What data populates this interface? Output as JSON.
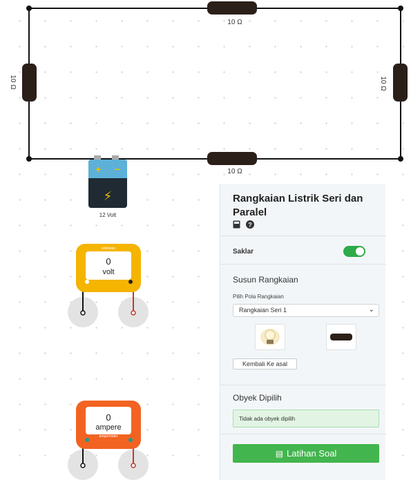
{
  "circuit": {
    "resistors": [
      {
        "label": "10 Ω"
      },
      {
        "label": "10 Ω"
      },
      {
        "label": "10 Ω"
      },
      {
        "label": "10 Ω"
      }
    ],
    "battery": {
      "label": "12 Volt",
      "plus": "+",
      "minus": "−",
      "bolt": "⚡"
    }
  },
  "voltmeter": {
    "title": "voltmeter",
    "value": "0",
    "unit": "volt"
  },
  "ammeter": {
    "title": "ampermeter",
    "value": "0",
    "unit": "ampere"
  },
  "panel": {
    "title": "Rangkaian Listrik Seri dan Paralel",
    "icons": [
      "calculator-icon",
      "help-icon"
    ],
    "saklar_label": "Saklar",
    "saklar_on": true,
    "susun_heading": "Susun Rangkaian",
    "pilih_label": "Pilih Pola Rangkaian",
    "select_value": "Rangkaian Seri 1",
    "tiles": [
      "bulb-icon",
      "resistor-icon"
    ],
    "reset_label": "Kembali Ke asal",
    "obyek_heading": "Obyek Dipilih",
    "obyek_info": "Tidak ada obyek dipilih",
    "latihan_label": "Latihan Soal",
    "colors": {
      "toggle": "#2eaa4a",
      "button": "#43b54e"
    }
  }
}
